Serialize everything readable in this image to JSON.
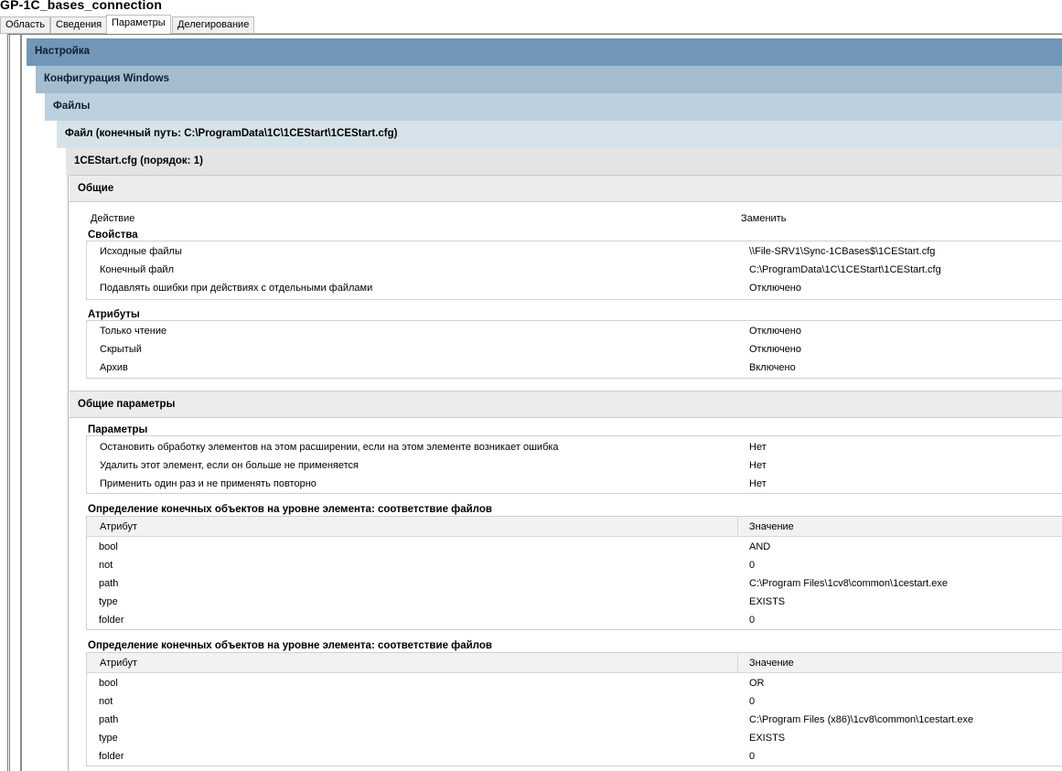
{
  "window": {
    "title": "GP-1C_bases_connection"
  },
  "tabs": [
    {
      "label": "Область",
      "active": false
    },
    {
      "label": "Сведения",
      "active": false
    },
    {
      "label": "Параметры",
      "active": true
    },
    {
      "label": "Делегирование",
      "active": false
    }
  ],
  "headers": {
    "settings": "Настройка",
    "windows_config": "Конфигурация Windows",
    "files": "Файлы",
    "file": "Файл (конечный путь: C:\\ProgramData\\1C\\1CEStart\\1CEStart.cfg)",
    "item": "1CEStart.cfg (порядок: 1)",
    "general": "Общие",
    "general_params": "Общие параметры"
  },
  "general": {
    "action_label": "Действие",
    "action_value": "Заменить",
    "properties_title": "Свойства",
    "properties": [
      {
        "label": "Исходные файлы",
        "value": "\\\\File-SRV1\\Sync-1CBases$\\1CEStart.cfg"
      },
      {
        "label": "Конечный файл",
        "value": "C:\\ProgramData\\1C\\1CEStart\\1CEStart.cfg"
      },
      {
        "label": "Подавлять ошибки при действиях с отдельными файлами",
        "value": "Отключено"
      }
    ],
    "attributes_title": "Атрибуты",
    "attributes": [
      {
        "label": "Только чтение",
        "value": "Отключено"
      },
      {
        "label": "Скрытый",
        "value": "Отключено"
      },
      {
        "label": "Архив",
        "value": "Включено"
      }
    ]
  },
  "common": {
    "params_title": "Параметры",
    "params": [
      {
        "label": "Остановить обработку элементов на этом расширении, если на этом элементе возникает ошибка",
        "value": "Нет"
      },
      {
        "label": "Удалить этот элемент, если он больше не применяется",
        "value": "Нет"
      },
      {
        "label": "Применить один раз и не применять повторно",
        "value": "Нет"
      }
    ],
    "targeting": [
      {
        "title": "Определение конечных объектов на уровне элемента: соответствие файлов",
        "col_attr": "Атрибут",
        "col_value": "Значение",
        "rows": [
          {
            "attr": "bool",
            "value": "AND"
          },
          {
            "attr": "not",
            "value": "0"
          },
          {
            "attr": "path",
            "value": "C:\\Program Files\\1cv8\\common\\1cestart.exe"
          },
          {
            "attr": "type",
            "value": "EXISTS"
          },
          {
            "attr": "folder",
            "value": "0"
          }
        ]
      },
      {
        "title": "Определение конечных объектов на уровне элемента: соответствие файлов",
        "col_attr": "Атрибут",
        "col_value": "Значение",
        "rows": [
          {
            "attr": "bool",
            "value": "OR"
          },
          {
            "attr": "not",
            "value": "0"
          },
          {
            "attr": "path",
            "value": "C:\\Program Files (x86)\\1cv8\\common\\1cestart.exe"
          },
          {
            "attr": "type",
            "value": "EXISTS"
          },
          {
            "attr": "folder",
            "value": "0"
          }
        ]
      }
    ]
  }
}
